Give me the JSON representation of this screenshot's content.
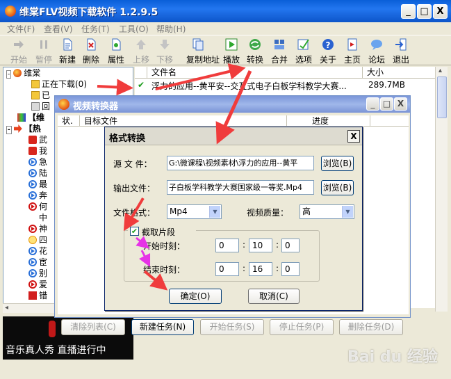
{
  "app": {
    "title": "维棠FLV视频下载软件  1.2.9.5",
    "window_controls": {
      "minimize": "_",
      "maximize": "□",
      "close": "X"
    }
  },
  "menu": [
    {
      "label": "文件(F)"
    },
    {
      "label": "查看(V)"
    },
    {
      "label": "任务(T)"
    },
    {
      "label": "工具(O)"
    },
    {
      "label": "帮助(H)"
    }
  ],
  "toolbar": [
    {
      "label": "开始",
      "icon": "arrow-right-icon",
      "enabled": false
    },
    {
      "label": "暂停",
      "icon": "pause-icon",
      "enabled": false
    },
    {
      "label": "新建",
      "icon": "new-document-icon",
      "enabled": true
    },
    {
      "label": "删除",
      "icon": "delete-icon",
      "enabled": true
    },
    {
      "label": "属性",
      "icon": "properties-icon",
      "enabled": true
    },
    {
      "label": "上移",
      "icon": "move-up-icon",
      "enabled": false
    },
    {
      "label": "下移",
      "icon": "move-down-icon",
      "enabled": false
    },
    {
      "label": "复制地址",
      "icon": "copy-address-icon",
      "enabled": true
    },
    {
      "label": "播放",
      "icon": "play-icon",
      "enabled": true
    },
    {
      "label": "转换",
      "icon": "convert-icon",
      "enabled": true
    },
    {
      "label": "合并",
      "icon": "merge-icon",
      "enabled": true
    },
    {
      "label": "选项",
      "icon": "options-icon",
      "enabled": true
    },
    {
      "label": "关于",
      "icon": "about-icon",
      "enabled": true
    },
    {
      "label": "主页",
      "icon": "homepage-icon",
      "enabled": true
    },
    {
      "label": "论坛",
      "icon": "forum-icon",
      "enabled": true
    },
    {
      "label": "退出",
      "icon": "exit-icon",
      "enabled": true
    }
  ],
  "tree": {
    "root": "维棠",
    "downloading": "正在下载(0)",
    "completed": "已",
    "recycle": "回",
    "vt_group": "【维",
    "hot_group": "【热",
    "channels": [
      "武",
      "我",
      "急",
      "陆",
      "最",
      "奔",
      "何",
      "中",
      "神",
      "四",
      "花",
      "宦",
      "别",
      "爱",
      "错"
    ]
  },
  "banner": {
    "text": "音乐真人秀 直播进行中"
  },
  "file_list": {
    "columns": [
      "文件名",
      "大小"
    ],
    "rows": [
      {
        "check": "✔",
        "name": "浮力的应用--黄平安--交互式电子白板学科教学大赛...",
        "size": "289.7MB"
      }
    ]
  },
  "bottom_buttons": [
    {
      "label": "清除列表(C)",
      "enabled": false
    },
    {
      "label": "新建任务(N)",
      "enabled": true
    },
    {
      "label": "开始任务(S)",
      "enabled": false
    },
    {
      "label": "停止任务(P)",
      "enabled": false
    },
    {
      "label": "删除任务(D)",
      "enabled": false
    }
  ],
  "converter": {
    "title": "视频转换器",
    "columns": [
      "状.",
      "目标文件",
      "进度"
    ]
  },
  "format_dialog": {
    "title": "格式转换",
    "close": "X",
    "source_label": "源 文 件：",
    "source_value": "G:\\微课程\\视频素材\\浮力的应用--黄平",
    "output_label": "输出文件：",
    "output_value": "子白板学科教学大赛国家级一等奖.Mp4",
    "browse_label": "浏览(B)",
    "format_label": "文件格式：",
    "format_value": "Mp4",
    "quality_label": "视频质量：",
    "quality_value": "高",
    "clip_label": "截取片段",
    "clip_checked": "✔",
    "start_label": "开始时刻：",
    "start": [
      "0",
      "10",
      "0"
    ],
    "end_label": "结束时刻：",
    "end": [
      "0",
      "16",
      "0"
    ],
    "ok_label": "确定(O)",
    "cancel_label": "取消(C)"
  },
  "watermark": "Bai du 经验",
  "colors": {
    "titlebar": "#2376ef",
    "annotation_red": "#f03c3c",
    "annotation_magenta": "#e632e6",
    "tree_play": "#2a70d8"
  }
}
